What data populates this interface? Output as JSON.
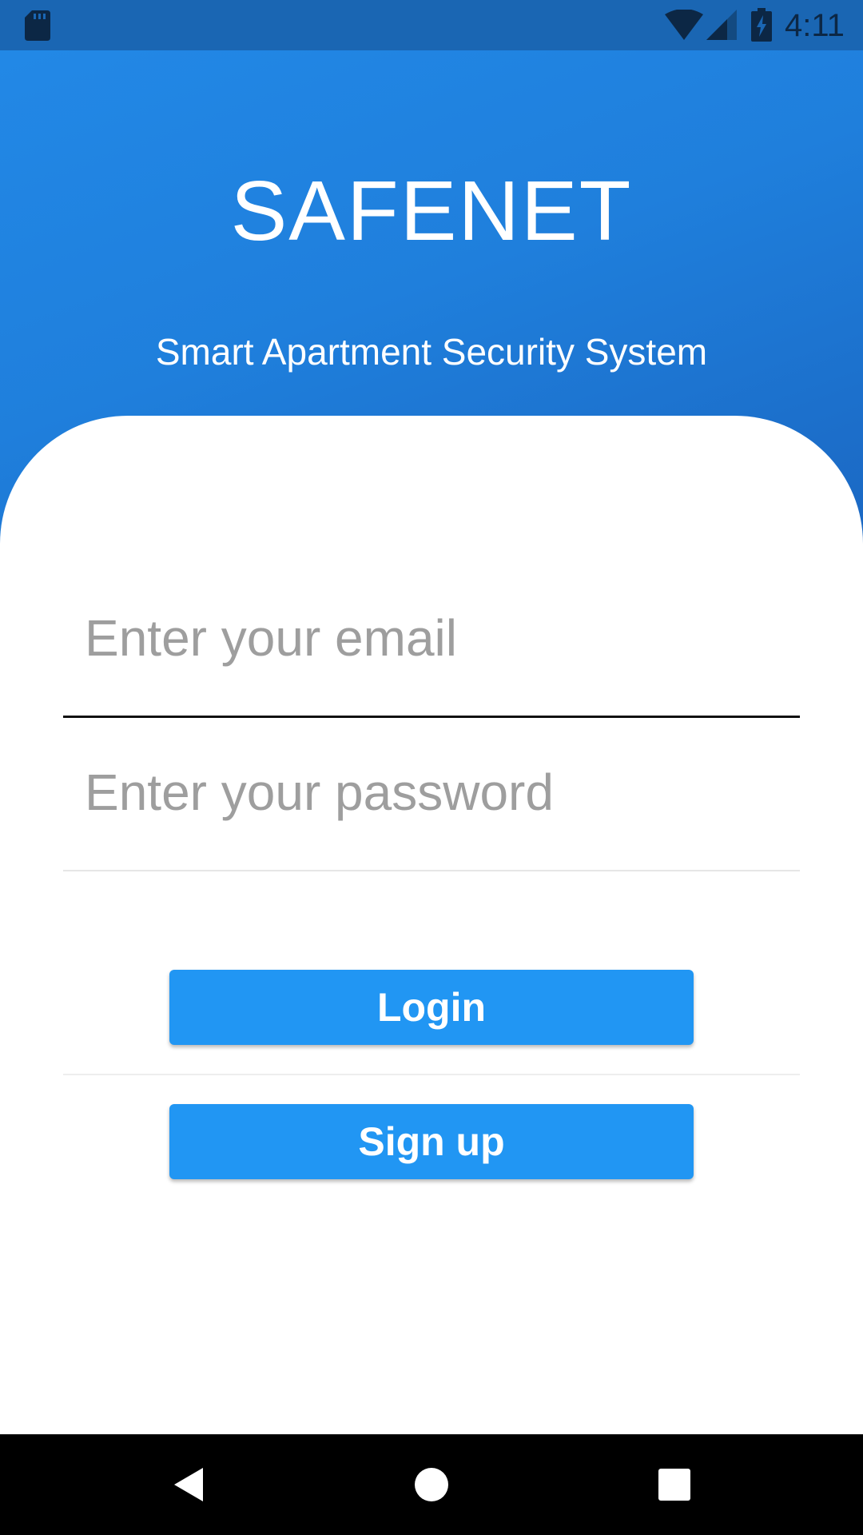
{
  "status_bar": {
    "time": "4:11",
    "icons": [
      "sd-card-icon",
      "wifi-icon",
      "cell-signal-icon",
      "battery-charging-icon"
    ]
  },
  "header": {
    "title": "SAFENET",
    "subtitle": "Smart Apartment Security System"
  },
  "form": {
    "email": {
      "placeholder": "Enter your email",
      "value": ""
    },
    "password": {
      "placeholder": "Enter your password",
      "value": ""
    },
    "login_label": "Login",
    "signup_label": "Sign up"
  },
  "nav_bar": {
    "icons": [
      "back-icon",
      "home-icon",
      "recents-icon"
    ]
  },
  "colors": {
    "header_gradient_start": "#2288e6",
    "header_gradient_end": "#1a65c0",
    "status_bar": "#1a66b3",
    "button": "#2196f3",
    "button_text": "#ffffff",
    "placeholder": "#9e9e9e"
  }
}
